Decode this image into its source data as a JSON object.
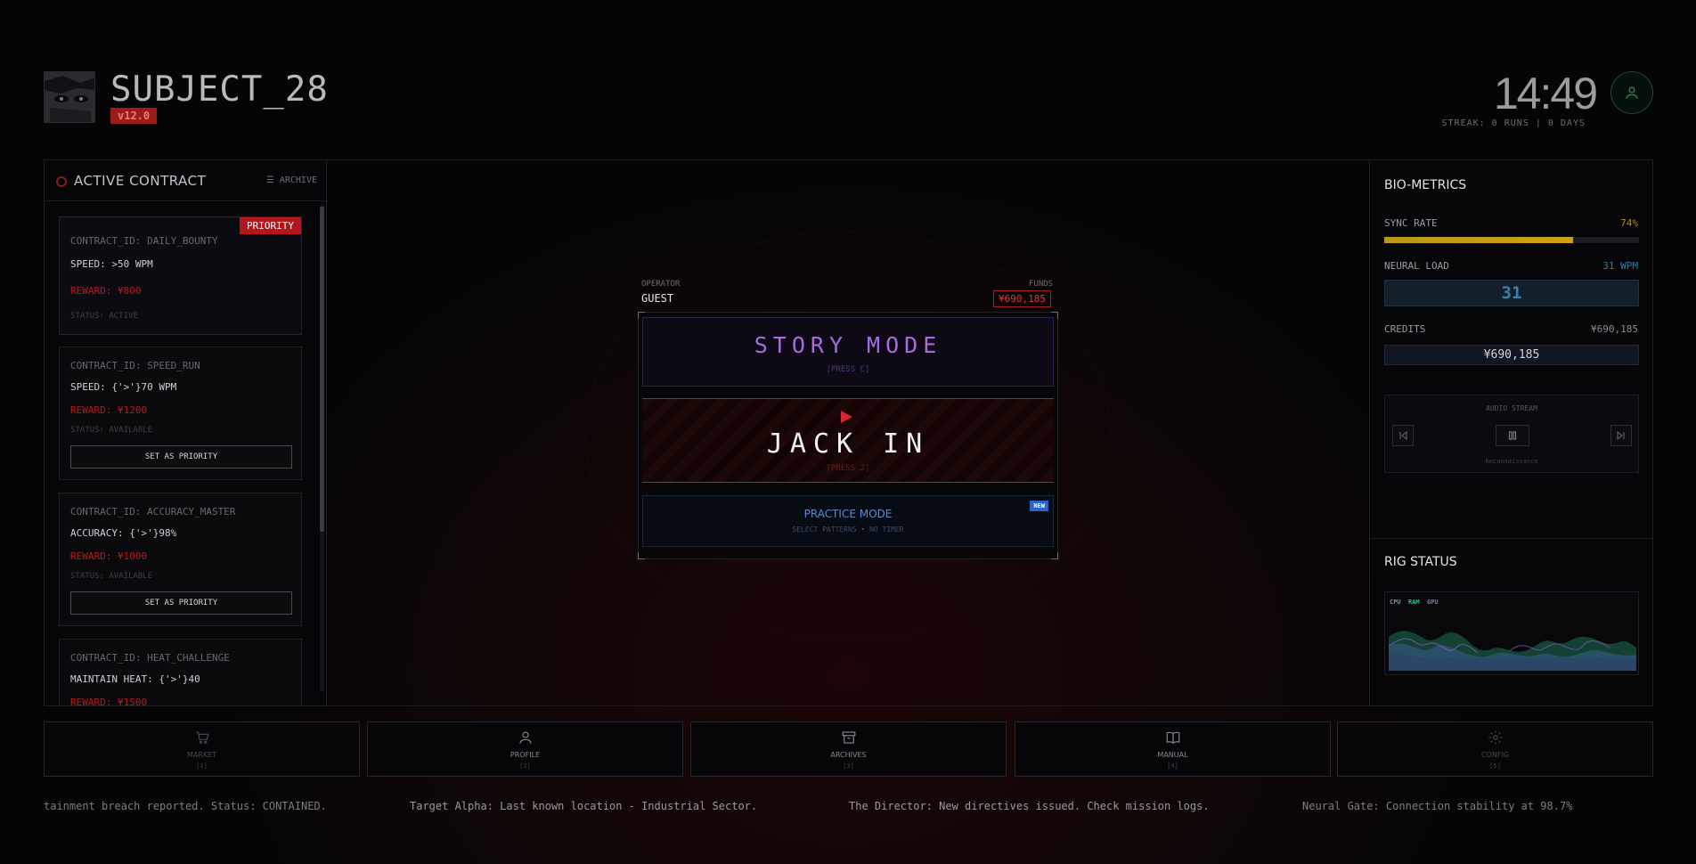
{
  "header": {
    "title": "SUBJECT_28",
    "version": "v12.0",
    "clock": "14:49",
    "streak": "STREAK: 0 RUNS | 0 DAYS"
  },
  "contracts": {
    "title": "ACTIVE CONTRACT",
    "archive_label": "ARCHIVE",
    "set_priority_label": "SET AS PRIORITY",
    "priority_tag": "PRIORITY",
    "items": [
      {
        "id": "CONTRACT_ID: DAILY_BOUNTY",
        "requirement": "SPEED: >50 WPM",
        "reward": "REWARD: ¥800",
        "status": "STATUS: ACTIVE"
      },
      {
        "id": "CONTRACT_ID: SPEED_RUN",
        "requirement": "SPEED: {'>'}70 WPM",
        "reward": "REWARD: ¥1200",
        "status": "STATUS: AVAILABLE"
      },
      {
        "id": "CONTRACT_ID: ACCURACY_MASTER",
        "requirement": "ACCURACY: {'>'}98%",
        "reward": "REWARD: ¥1000",
        "status": "STATUS: AVAILABLE"
      },
      {
        "id": "CONTRACT_ID: HEAT_CHALLENGE",
        "requirement": "MAINTAIN HEAT: {'>'}40",
        "reward": "REWARD: ¥1500"
      }
    ]
  },
  "center": {
    "operator_label": "OPERATOR",
    "operator": "GUEST",
    "funds_label": "FUNDS",
    "funds": "¥690,185",
    "story": {
      "title": "STORY MODE",
      "key": "[PRESS C]"
    },
    "jack": {
      "title": "JACK IN",
      "key": "[PRESS J]"
    },
    "practice": {
      "title": "PRACTICE MODE",
      "sub": "SELECT PATTERNS • NO TIMER",
      "badge": "NEW"
    }
  },
  "bio": {
    "title": "BIO-METRICS",
    "sync_label": "SYNC RATE",
    "sync_value": "74%",
    "sync_fraction": 0.74,
    "load_label": "NEURAL LOAD",
    "load_value": "31 WPM",
    "load_big": "31",
    "credits_label": "CREDITS",
    "credits_value": "¥690,185",
    "credits_box": "¥690,185",
    "audio_title": "AUDIO STREAM",
    "track": "Reconnaissance"
  },
  "rig": {
    "title": "RIG STATUS",
    "legend": [
      "CPU",
      "RAM",
      "GPU"
    ],
    "colors": {
      "cpu": "#4aa3d6",
      "ram": "#2fbf8a",
      "gpu": "#9a6ad8"
    }
  },
  "nav": [
    {
      "label": "MARKET",
      "key": "[1]",
      "icon": "cart-icon"
    },
    {
      "label": "PROFILE",
      "key": "[2]",
      "icon": "user-icon"
    },
    {
      "label": "ARCHIVES",
      "key": "[3]",
      "icon": "archive-icon"
    },
    {
      "label": "MANUAL",
      "key": "[4]",
      "icon": "book-icon"
    },
    {
      "label": "CONFIG",
      "key": "[5]",
      "icon": "gear-icon"
    }
  ],
  "ticker": [
    "tainment breach reported. Status: CONTAINED.",
    "Target Alpha: Last known location - Industrial Sector.",
    "The Director: New directives issued. Check mission logs.",
    "Neural Gate: Connection stability at 98.7%"
  ]
}
